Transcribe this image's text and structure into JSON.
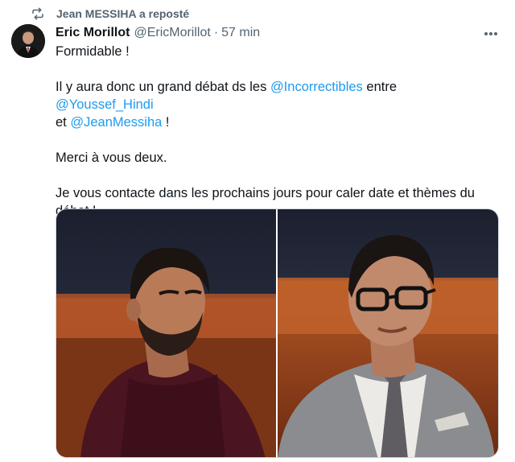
{
  "repost": {
    "label": "Jean MESSIHA a reposté",
    "icon": "repost-icon"
  },
  "tweet": {
    "author_name": "Eric Morillot",
    "author_handle": "@EricMorillot",
    "separator": "·",
    "time": "57 min",
    "more_icon": "more-options-icon",
    "lines": {
      "l1": "Formidable !",
      "l2_a": "Il y aura donc un grand débat ds les ",
      "l2_m1": "@Incorrectibles",
      "l2_b": " entre ",
      "l2_m2": "@Youssef_Hindi",
      "l3_a": "et ",
      "l3_m1": "@JeanMessiha",
      "l3_b": " !",
      "l4": "Merci à vous deux.",
      "l5": "Je vous contacte dans les prochains jours pour caler date et thèmes du",
      "l6": "débat !"
    },
    "media": [
      {
        "description_icon": "photo-young-man-beard"
      },
      {
        "description_icon": "photo-man-glasses-suit"
      }
    ]
  },
  "colors": {
    "text": "#0f1419",
    "secondary": "#536471",
    "link": "#1d9bf0",
    "border": "#cfd9de"
  }
}
